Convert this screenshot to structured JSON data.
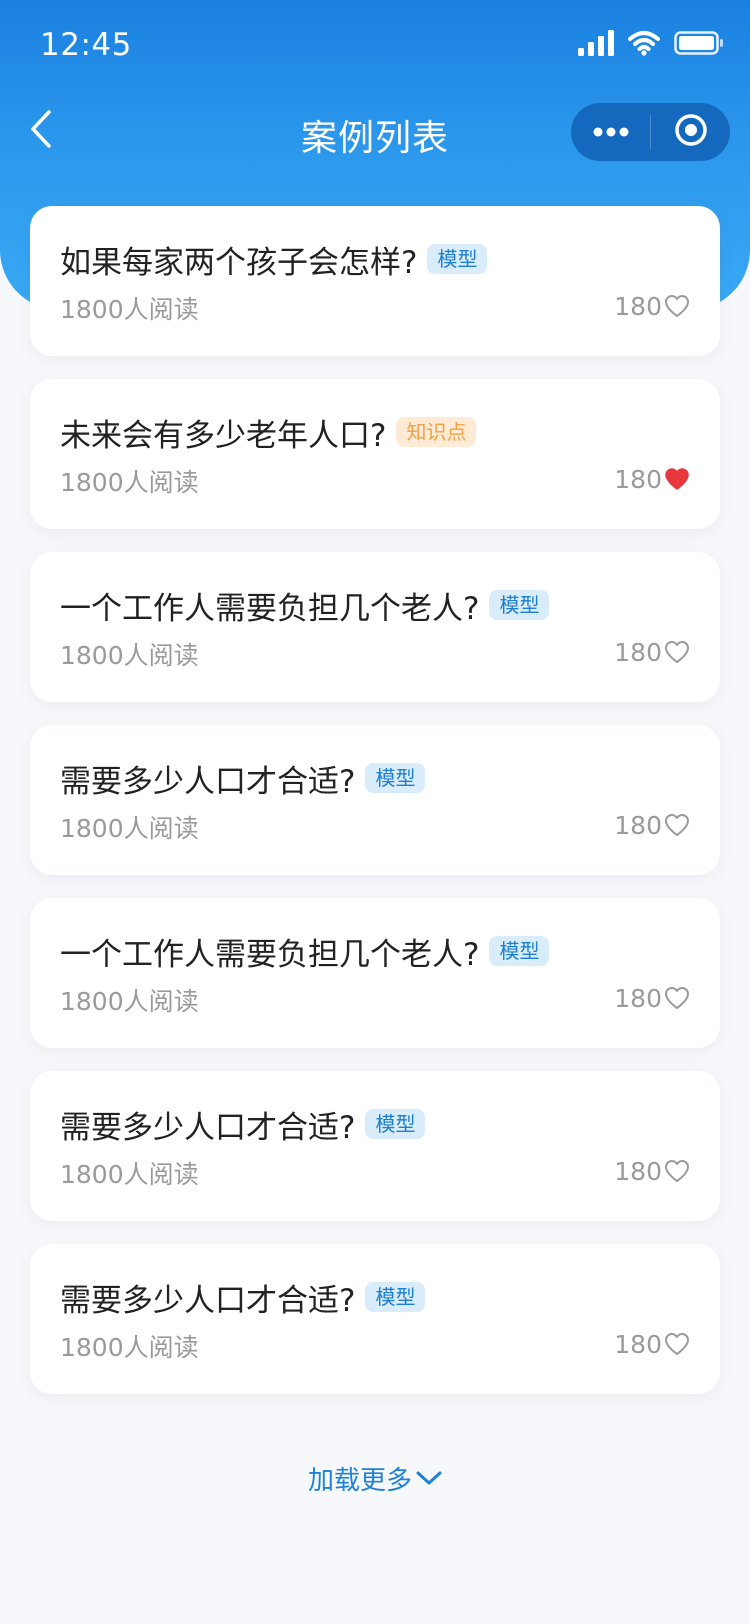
{
  "status_bar": {
    "time": "12:45"
  },
  "nav": {
    "title": "案例列表"
  },
  "colors": {
    "header_top": "#1a80e0",
    "header_bottom": "#3aa9f4",
    "tag_blue_text": "#1e7fd0",
    "tag_orange_text": "#f0a046",
    "heart_filled": "#e8373d",
    "link": "#1e82d6"
  },
  "cards": [
    {
      "title": "如果每家两个孩子会怎样?",
      "tag": "模型",
      "tag_color": "blue",
      "reads": "1800人阅读",
      "likes": "180",
      "liked": false
    },
    {
      "title": "未来会有多少老年人口?",
      "tag": "知识点",
      "tag_color": "orange",
      "reads": "1800人阅读",
      "likes": "180",
      "liked": true
    },
    {
      "title": "一个工作人需要负担几个老人?",
      "tag": "模型",
      "tag_color": "blue",
      "reads": "1800人阅读",
      "likes": "180",
      "liked": false
    },
    {
      "title": "需要多少人口才合适?",
      "tag": "模型",
      "tag_color": "blue",
      "reads": "1800人阅读",
      "likes": "180",
      "liked": false
    },
    {
      "title": "一个工作人需要负担几个老人?",
      "tag": "模型",
      "tag_color": "blue",
      "reads": "1800人阅读",
      "likes": "180",
      "liked": false
    },
    {
      "title": "需要多少人口才合适?",
      "tag": "模型",
      "tag_color": "blue",
      "reads": "1800人阅读",
      "likes": "180",
      "liked": false
    },
    {
      "title": "需要多少人口才合适?",
      "tag": "模型",
      "tag_color": "blue",
      "reads": "1800人阅读",
      "likes": "180",
      "liked": false
    }
  ],
  "load_more": {
    "label": "加载更多",
    "icon": "chevron-down-icon"
  }
}
